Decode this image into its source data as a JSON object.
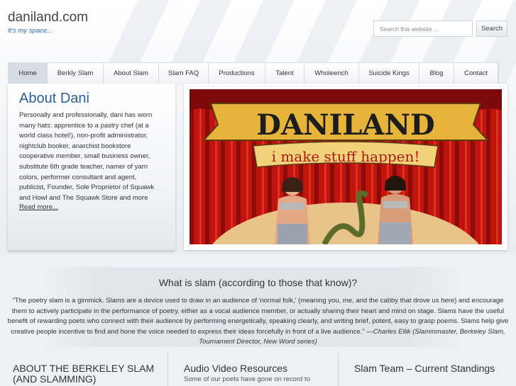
{
  "site": {
    "title": "daniland.com",
    "tagline": "It's my space..."
  },
  "search": {
    "placeholder": "Search this website ...",
    "button_label": "Search"
  },
  "nav": {
    "items": [
      {
        "label": "Home",
        "active": true
      },
      {
        "label": "Berkly Slam"
      },
      {
        "label": "About Slam"
      },
      {
        "label": "Slam FAQ"
      },
      {
        "label": "Productions"
      },
      {
        "label": "Talent"
      },
      {
        "label": "Wholeench"
      },
      {
        "label": "Suicide Kings"
      },
      {
        "label": "Blog"
      },
      {
        "label": "Contact"
      }
    ]
  },
  "about": {
    "title": "About Dani",
    "text": "Personally and professionally, dani has worn many hats: apprentice to a pastry chef (at a world class hotel!), non-profit administrator, nightclub booker, anarchist bookstore cooperative member, small business owner, substitute 6th grade teacher, namer of yarn colors, performer consultant and agent, publicist, Founder, Sole Proprietor of Squawk and Howl and The Squawk Store and more",
    "read_more": "Read more..."
  },
  "banner": {
    "title": "DANILAND",
    "subtitle": "i make stuff happen!"
  },
  "slam": {
    "title": "What is slam (according to those that know)?",
    "quote": "\"The poetry slam is a gimmick. Slams are a device used to draw in an audience of 'normal folk,' (meaning you, me, and the cabby that drove us here) and encourage them to actively participate in the performance of poetry, either as a vocal audience member, or actually sharing their heart and mind on stage. Slams have the useful benefit of rewarding poets who connect with their audience by performing energetically, speaking clearly, and writing brief, potent, easy to grasp poems. Slams help give creative people incentive to find and hone the voice needed to express their ideas forcefully in front of a live audience.\" ",
    "attribution": "—Charles Ellik (Slammmaster, Berkeley Slam, Tournament Director, New Word series)"
  },
  "columns": {
    "col1_title": "ABOUT THE BERKELEY SLAM (AND SLAMMING)",
    "col2_title": "Audio Video Resources",
    "col2_text": "Some of our poets have gone on record to",
    "col3_title": "Slam Team – Current Standings"
  },
  "colors": {
    "accent": "#2b5f92",
    "tagline": "#2a6cb4",
    "nav_active": "#d7dce4"
  }
}
